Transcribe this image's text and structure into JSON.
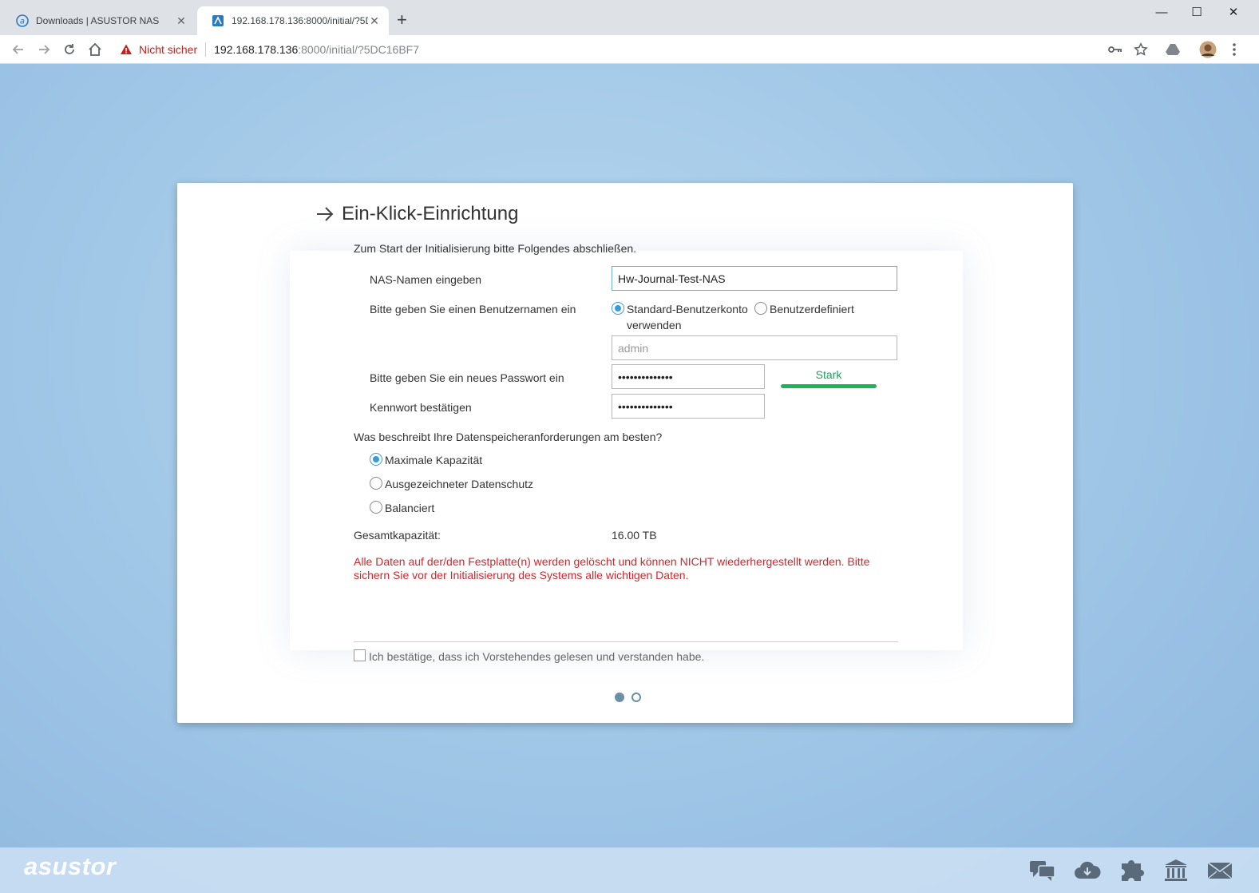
{
  "browser": {
    "tabs": [
      {
        "title": "Downloads | ASUSTOR NAS",
        "active": false
      },
      {
        "title": "192.168.178.136:8000/initial/?5D",
        "active": true
      }
    ],
    "address": {
      "security_label": "Nicht sicher",
      "host": "192.168.178.136",
      "path": ":8000/initial/?5DC16BF7"
    }
  },
  "wizard": {
    "title": "Ein-Klick-Einrichtung",
    "intro": "Zum Start der Initialisierung bitte Folgendes abschließen.",
    "nas_name": {
      "label": "NAS-Namen eingeben",
      "value": "Hw-Journal-Test-NAS"
    },
    "username": {
      "label": "Bitte geben Sie einen Benutzernamen ein",
      "option_default_line1": "Standard-Benutzerkonto",
      "option_default_line2": "verwenden",
      "option_custom": "Benutzerdefiniert",
      "selected": "default",
      "placeholder": "admin"
    },
    "password": {
      "label": "Bitte geben Sie ein neues Passwort ein",
      "value": "••••••••••••••",
      "strength": "Stark"
    },
    "confirm": {
      "label": "Kennwort bestätigen",
      "value": "••••••••••••••"
    },
    "storage": {
      "question": "Was beschreibt Ihre Datenspeicheranforderungen am besten?",
      "options": [
        "Maximale Kapazität",
        "Ausgezeichneter Datenschutz",
        "Balanciert"
      ],
      "selected": 0
    },
    "capacity": {
      "label": "Gesamtkapazität:",
      "value": "16.00 TB"
    },
    "warning": "Alle Daten auf der/den Festplatte(n) werden gelöscht und können NICHT wiederhergestellt werden. Bitte sichern Sie vor der Initialisierung des Systems alle wichtigen Daten.",
    "acknowledge": "Ich bestätige, dass ich Vorstehendes gelesen und verstanden habe.",
    "pagination": {
      "current": 1,
      "total": 2
    }
  },
  "footer": {
    "brand": "asustor",
    "icons": [
      "chat-icon",
      "cloud-download-icon",
      "plugin-icon",
      "bank-icon",
      "mail-icon"
    ]
  },
  "colors": {
    "accent": "#3a9bdc",
    "strength_ok": "#1cb457",
    "warning": "#d0272d",
    "background": "#a3c9e8"
  }
}
